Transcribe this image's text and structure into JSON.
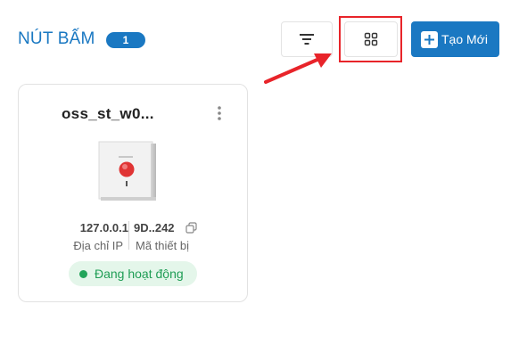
{
  "header": {
    "title": "NÚT BẤM",
    "count": "1",
    "create_label": "Tạo Mới"
  },
  "icons": {
    "filter": "filter-lines-icon",
    "grid": "grid-view-icon",
    "plus": "plus-icon",
    "more": "more-vertical-icon",
    "copy": "copy-icon"
  },
  "cards": [
    {
      "title": "oss_st_w0...",
      "ip_value": "127.0.0.1",
      "ip_label": "Địa chỉ IP",
      "mac_value": "9D..242",
      "mac_label": "Mã thiết bị",
      "status": "Đang hoạt động"
    }
  ],
  "colors": {
    "accent": "#1a78c2",
    "highlight": "#e8242a",
    "status_bg": "#e4f6ea",
    "status_text": "#1f9d55"
  }
}
